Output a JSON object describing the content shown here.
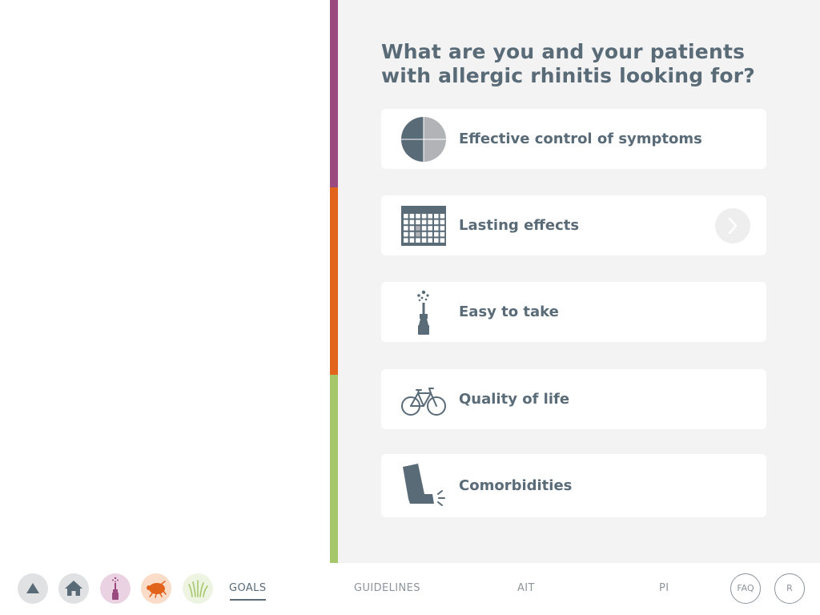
{
  "colors": {
    "accent_purple": "#9b4a80",
    "accent_orange": "#e2631c",
    "accent_green": "#a5c76a",
    "text_primary": "#5a6b78",
    "text_muted": "#8c959c",
    "panel_background": "#f3f3f3"
  },
  "side_stripe": [
    "accent_purple",
    "accent_orange",
    "accent_green"
  ],
  "main": {
    "question": "What are you and your patients with allergic rhinitis looking for?",
    "goals": [
      {
        "label": "Effective control of symptoms",
        "icon": "pie-chart-icon"
      },
      {
        "label": "Lasting effects",
        "icon": "calendar-icon",
        "arrow_icon": "chevron-right-icon"
      },
      {
        "label": "Easy to take",
        "icon": "spray-bottle-icon"
      },
      {
        "label": "Quality of life",
        "icon": "bicycle-icon"
      },
      {
        "label": "Comorbidities",
        "icon": "inhaler-icon"
      }
    ]
  },
  "bottom_nav": {
    "icons": [
      "up-arrow-icon",
      "home-icon",
      "spray-bottle-icon",
      "dust-mite-icon",
      "grass-icon"
    ],
    "links": [
      "GOALS",
      "GUIDELINES",
      "AIT",
      "PI"
    ],
    "active_link": "GOALS",
    "faq_label": "FAQ",
    "r_label": "R"
  }
}
